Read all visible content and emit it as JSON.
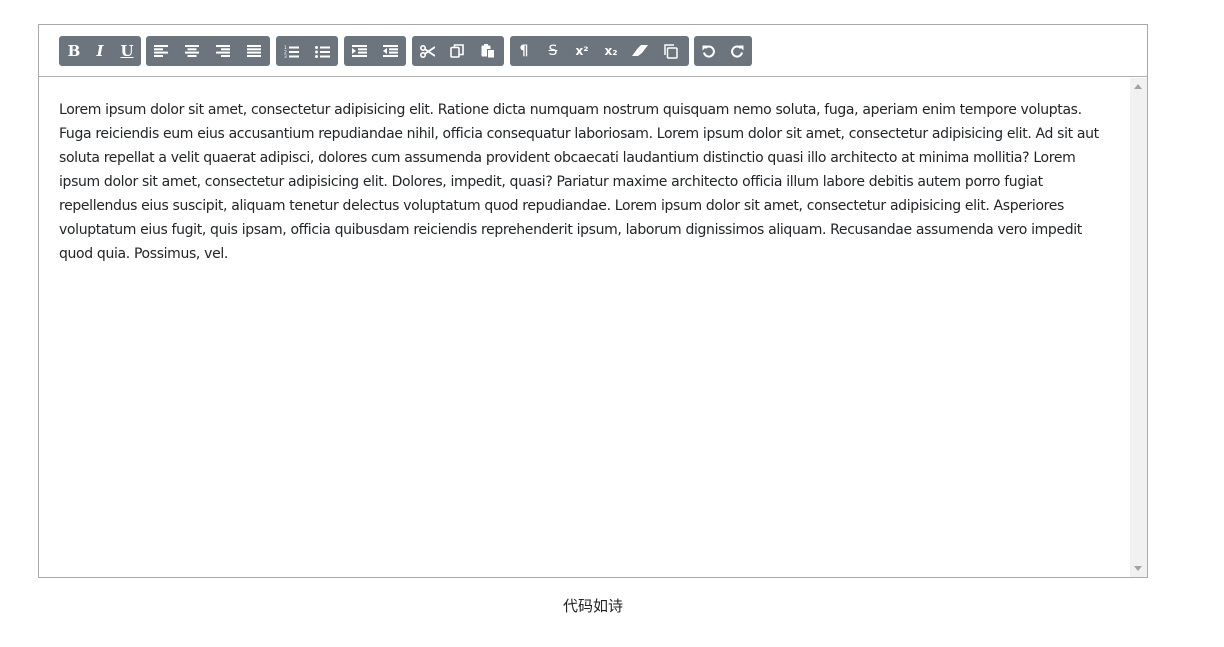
{
  "toolbar": {
    "bold_label": "B",
    "italic_label": "I",
    "underline_label": "U",
    "superscript_label": "x²",
    "subscript_label": "x₂",
    "paragraph_label": "¶",
    "strike_label": "S",
    "button_color": "#6c757d"
  },
  "content": {
    "text": "Lorem ipsum dolor sit amet, consectetur adipisicing elit. Ratione dicta numquam nostrum quisquam nemo soluta, fuga, aperiam enim tempore voluptas. Fuga reiciendis eum eius accusantium repudiandae nihil, officia consequatur laboriosam. Lorem ipsum dolor sit amet, consectetur adipisicing elit. Ad sit aut soluta repellat a velit quaerat adipisci, dolores cum assumenda provident obcaecati laudantium distinctio quasi illo architecto at minima mollitia? Lorem ipsum dolor sit amet, consectetur adipisicing elit. Dolores, impedit, quasi? Pariatur maxime architecto officia illum labore debitis autem porro fugiat repellendus eius suscipit, aliquam tenetur delectus voluptatum quod repudiandae. Lorem ipsum dolor sit amet, consectetur adipisicing elit. Asperiores voluptatum eius fugit, quis ipsam, officia quibusdam reiciendis reprehenderit ipsum, laborum dignissimos aliquam. Recusandae assumenda vero impedit quod quia. Possimus, vel."
  },
  "footer": {
    "text": "代码如诗"
  }
}
